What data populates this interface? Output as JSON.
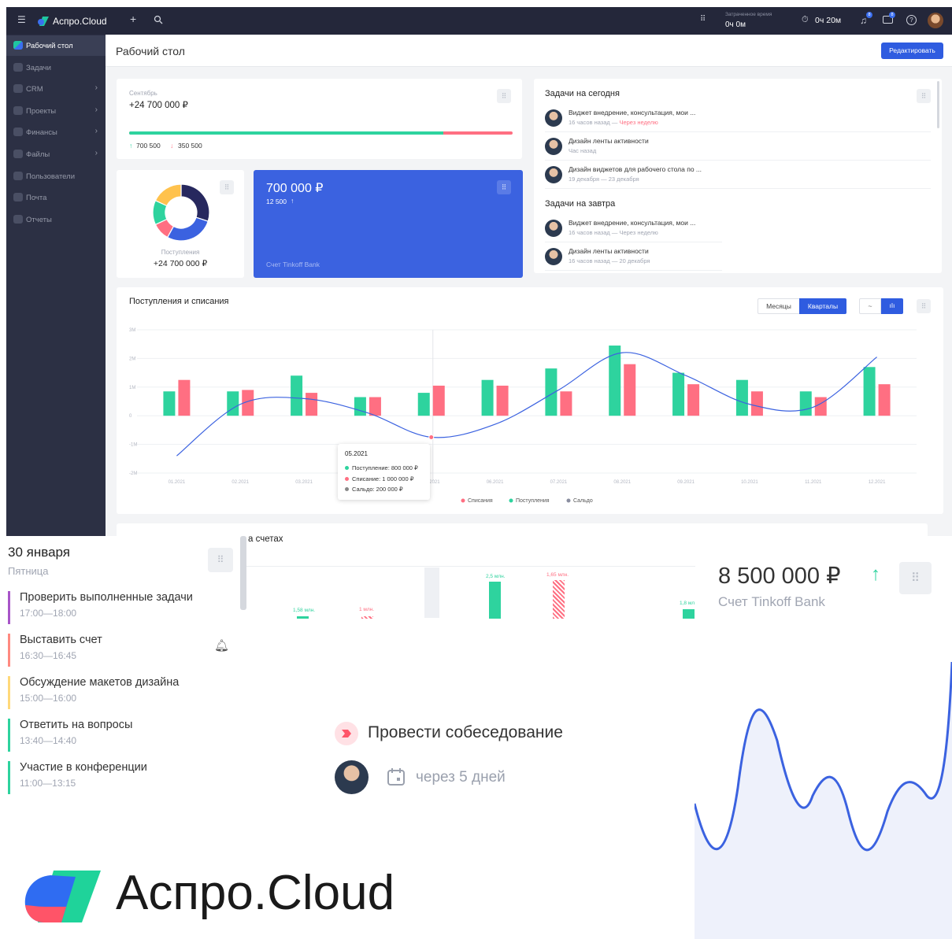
{
  "topbar": {
    "app_name": "Аспро.Cloud",
    "time_spent_label": "Затраченное время",
    "time_spent_value": "0ч 0м",
    "timer_value": "0ч 20м",
    "notif_badge": "8",
    "msg_badge": "8",
    "icons": [
      "menu-icon",
      "logo-icon",
      "plus-icon",
      "search-icon",
      "apps-grid-icon",
      "timer-icon",
      "bell-icon",
      "chat-icon",
      "help-icon",
      "avatar"
    ]
  },
  "sidebar": {
    "items": [
      {
        "label": "Рабочий стол",
        "active": true
      },
      {
        "label": "Задачи"
      },
      {
        "label": "CRM",
        "arrow": true
      },
      {
        "label": "Проекты",
        "arrow": true
      },
      {
        "label": "Финансы",
        "arrow": true
      },
      {
        "label": "Файлы",
        "arrow": true
      },
      {
        "label": "Пользователи"
      },
      {
        "label": "Почта"
      },
      {
        "label": "Отчеты"
      }
    ]
  },
  "header": {
    "title": "Рабочий стол",
    "edit_button": "Редактировать"
  },
  "month_card": {
    "month": "Сентябрь",
    "amount": "+24 700 000 ₽",
    "income": "700 500",
    "expense": "350 500",
    "income_fraction": 0.82
  },
  "donut_card": {
    "label": "Поступления",
    "amount": "+24 700 000 ₽",
    "segments": [
      {
        "value": 30,
        "color": "#27285e"
      },
      {
        "value": 28,
        "color": "#3b62e0"
      },
      {
        "value": 10,
        "color": "#ff6f82"
      },
      {
        "value": 14,
        "color": "#2ed39e"
      },
      {
        "value": 18,
        "color": "#ffc24d"
      }
    ]
  },
  "bank_card": {
    "amount": "700 000 ₽",
    "delta": "12 500",
    "label": "Счет Tinkoff Bank",
    "color": "#3b62e0"
  },
  "tasks_card": {
    "today_title": "Задачи на сегодня",
    "today": [
      {
        "title": "Виджет внедрение, консультация, мои ...",
        "meta": "16 часов назад — ",
        "meta_red": "Через неделю"
      },
      {
        "title": "Дизайн ленты активности",
        "meta": "Час назад",
        "meta_red": ""
      },
      {
        "title": "Дизайн виджетов для рабочего стола по ...",
        "meta": "19 декабря — 23 декабря",
        "meta_red": ""
      }
    ],
    "tomorrow_title": "Задачи на завтра",
    "tomorrow": [
      {
        "title": "Виджет внедрение, консультация, мои ...",
        "meta": "16 часов назад — Через неделю"
      },
      {
        "title": "Дизайн ленты активности",
        "meta": "16 часов назад — 20 декабря"
      }
    ]
  },
  "chart_card": {
    "title": "Поступления и списания",
    "tab_months": "Месяцы",
    "tab_quarters": "Кварталы"
  },
  "chart_data": {
    "type": "bar",
    "title": "Поступления и списания",
    "categories": [
      "01.2021",
      "02.2021",
      "03.2021",
      "04.2021",
      "05.2021",
      "06.2021",
      "07.2021",
      "08.2021",
      "09.2021",
      "10.2021",
      "11.2021",
      "12.2021"
    ],
    "series": [
      {
        "name": "Поступления",
        "color": "#2ed39e",
        "values": [
          0.85,
          0.85,
          1.4,
          0.65,
          0.8,
          1.25,
          1.65,
          2.45,
          1.5,
          1.25,
          0.85,
          1.7
        ]
      },
      {
        "name": "Списания",
        "color": "#ff6f82",
        "values": [
          1.25,
          0.9,
          0.8,
          0.65,
          1.05,
          1.05,
          0.85,
          1.8,
          1.1,
          0.85,
          0.65,
          1.1
        ]
      },
      {
        "name": "Сальдо",
        "color": "#3b62e0",
        "type": "line",
        "values": [
          -1.4,
          0.4,
          0.6,
          0.1,
          -0.75,
          -0.3,
          0.9,
          2.2,
          1.4,
          0.4,
          0.3,
          2.05
        ]
      }
    ],
    "yticks": [
      "3M",
      "2M",
      "1M",
      "0",
      "-1M",
      "-2M"
    ],
    "ylim": [
      -2,
      3
    ],
    "legend": [
      "Списания",
      "Поступления",
      "Сальдо"
    ],
    "tooltip": {
      "date": "05.2021",
      "lines": [
        "Поступление: 800 000 ₽",
        "Списание: 1 000 000 ₽",
        "Сальдо: 200 000 ₽"
      ]
    }
  },
  "accounts_card": {
    "title_fragment": "а счетах",
    "labels": [
      "1,58 млн.",
      "1 млн.",
      "2,5 млн.",
      "1,65 млн.",
      "1,8 мл"
    ]
  },
  "calendar": {
    "date": "30 января",
    "weekday": "Пятница",
    "events": [
      {
        "title": "Проверить выполненные задачи",
        "time": "17:00—18:00",
        "color": "#a855c8"
      },
      {
        "title": "Выставить счет",
        "time": "16:30—16:45",
        "color": "#ff8a80"
      },
      {
        "title": "Обсуждение макетов дизайна",
        "time": "15:00—16:00",
        "color": "#ffd97a"
      },
      {
        "title": "Ответить на вопросы",
        "time": "13:40—14:40",
        "color": "#2ed39e"
      },
      {
        "title": "Участие в конференции",
        "time": "11:00—13:15",
        "color": "#2ed39e"
      }
    ]
  },
  "big_bank": {
    "amount": "8 500 000 ₽",
    "label": "Счет Tinkoff Bank"
  },
  "interview": {
    "title": "Провести собеседование",
    "due": "через 5 дней"
  },
  "logo": {
    "text": "Аспро.Cloud"
  }
}
